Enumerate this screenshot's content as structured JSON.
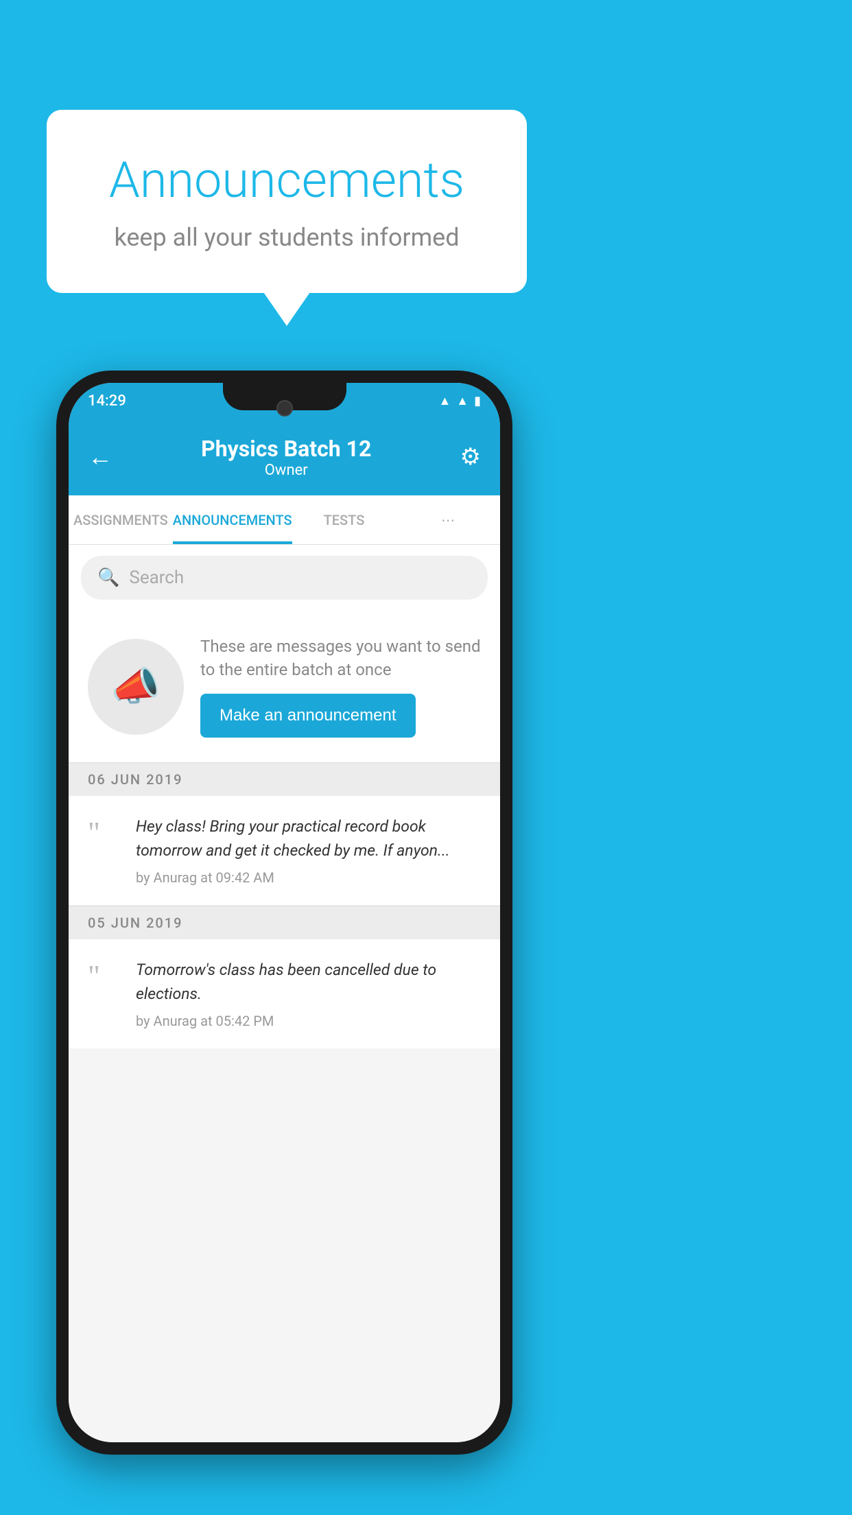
{
  "background_color": "#1db8e8",
  "speech_bubble": {
    "title": "Announcements",
    "subtitle": "keep all your students informed"
  },
  "phone": {
    "status_bar": {
      "time": "14:29"
    },
    "header": {
      "title": "Physics Batch 12",
      "subtitle": "Owner",
      "back_label": "←",
      "gear_label": "⚙"
    },
    "tabs": [
      {
        "label": "ASSIGNMENTS",
        "active": false
      },
      {
        "label": "ANNOUNCEMENTS",
        "active": true
      },
      {
        "label": "TESTS",
        "active": false
      },
      {
        "label": "⋯",
        "active": false
      }
    ],
    "search": {
      "placeholder": "Search"
    },
    "promo": {
      "description": "These are messages you want to send to the entire batch at once",
      "button_label": "Make an announcement"
    },
    "announcements": [
      {
        "date": "06  JUN  2019",
        "text": "Hey class! Bring your practical record book tomorrow and get it checked by me. If anyon...",
        "meta": "by Anurag at 09:42 AM"
      },
      {
        "date": "05  JUN  2019",
        "text": "Tomorrow's class has been cancelled due to elections.",
        "meta": "by Anurag at 05:42 PM"
      }
    ]
  }
}
